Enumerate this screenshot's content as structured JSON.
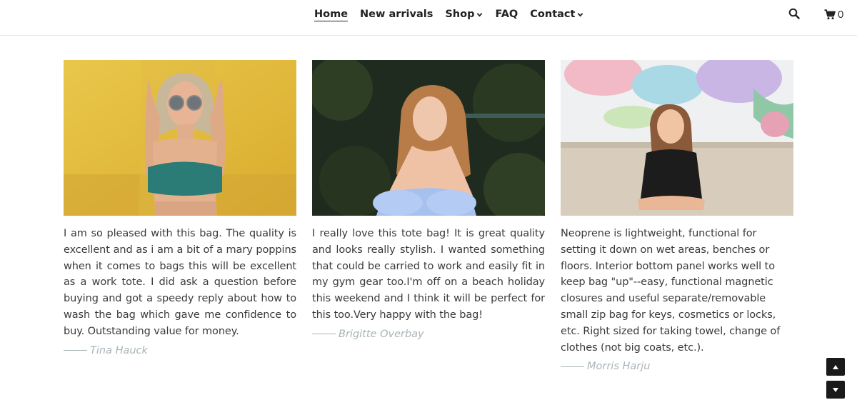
{
  "nav": {
    "items": [
      {
        "label": "Home",
        "active": true,
        "dropdown": false
      },
      {
        "label": "New arrivals",
        "active": false,
        "dropdown": false
      },
      {
        "label": "Shop",
        "active": false,
        "dropdown": true
      },
      {
        "label": "FAQ",
        "active": false,
        "dropdown": false
      },
      {
        "label": "Contact",
        "active": false,
        "dropdown": true
      }
    ],
    "search_icon": "search-icon",
    "cart_icon": "cart-icon",
    "cart_count": "0"
  },
  "testimonials": [
    {
      "photo": "woman-yellow-wall-sunglasses",
      "text": "I am so pleased with this bag. The quality is excellent and as i am a bit of a mary poppins when it comes to bags this will be excellent as a work tote. I did ask a question before buying and got a speedy reply about how to wash the bag which gave me confidence to buy. Outstanding value for money.",
      "author": "Tina Hauck"
    },
    {
      "photo": "woman-blue-dress-garden",
      "text": "I really love this tote bag! It is great quality and looks really stylish. I wanted something that could be carried to work and easily fit in my gym gear too.I'm off on a beach holiday this weekend and I think it will be perfect for this too.Very happy with the bag!",
      "author": "Brigitte Overbay"
    },
    {
      "photo": "woman-black-dress-mural",
      "text": "Neoprene is lightweight, functional for setting it down on wet areas, benches or floors. Interior bottom panel works well to keep bag \"up\"--easy, functional magnetic closures and useful separate/removable small zip bag for keys, cosmetics or locks, etc. Right sized for taking towel, change of clothes (not big coats, etc.).",
      "author": "Morris Harju"
    }
  ],
  "colors": {
    "author": "#a9b4b8",
    "text": "#3a3a3a",
    "scroll_button": "#1a1a1a"
  },
  "scroll": {
    "up_icon": "arrow-up-icon",
    "down_icon": "arrow-down-icon"
  }
}
